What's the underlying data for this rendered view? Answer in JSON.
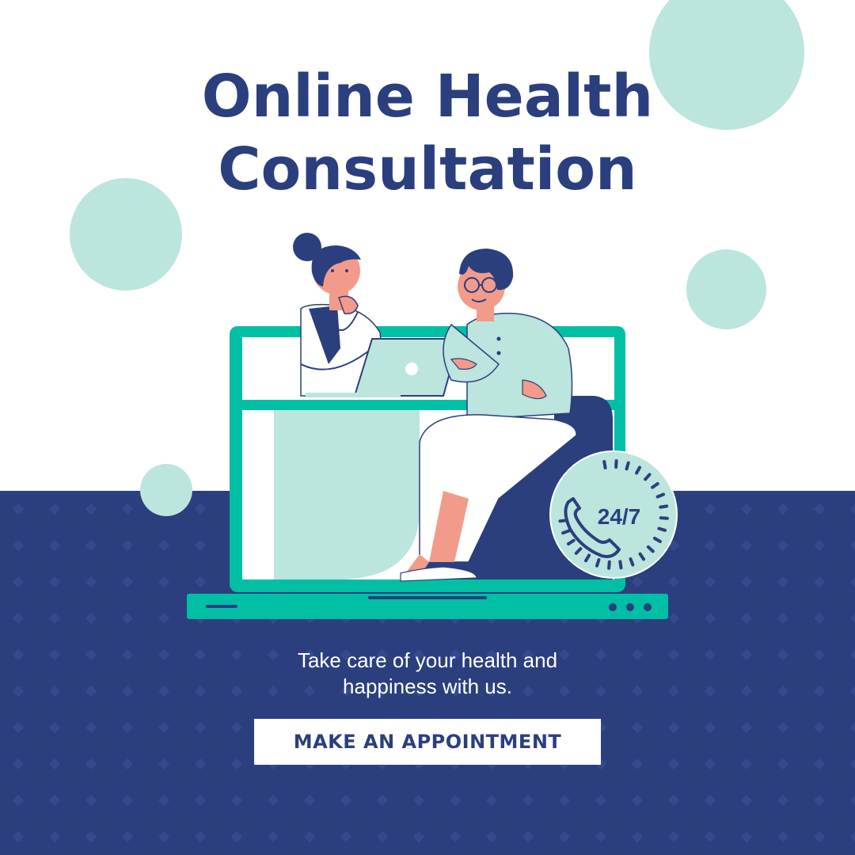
{
  "colors": {
    "navy": "#2b3f7e",
    "mint": "#bbe5dd",
    "teal": "#00bfa5",
    "skin": "#f39b8a",
    "white": "#ffffff"
  },
  "headline": {
    "line1": "Online Health",
    "line2": "Consultation"
  },
  "illustration": {
    "badge_text": "24/7",
    "badge_icon": "phone-icon"
  },
  "tagline": {
    "line1": "Take care of your health and",
    "line2": "happiness with us."
  },
  "cta": {
    "label": "MAKE AN APPOINTMENT"
  }
}
